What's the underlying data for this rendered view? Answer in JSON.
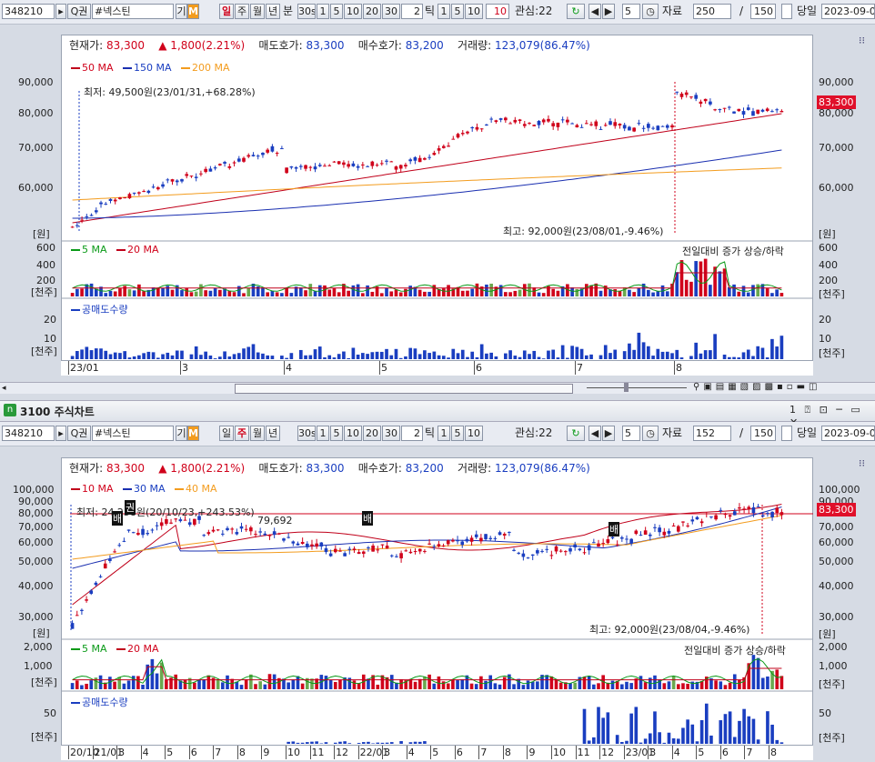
{
  "top": {
    "toolbar": {
      "code": "348210",
      "name": "#넥스틴",
      "gi": "기",
      "m": "M",
      "periods": [
        "일",
        "주",
        "월",
        "년",
        "분",
        "30s",
        "1",
        "5",
        "10",
        "20",
        "30"
      ],
      "tick_value": "2",
      "tick_label": "틱",
      "tick_opts": [
        "1",
        "5",
        "10",
        "10"
      ],
      "gwansim": "관심:22",
      "num5": "5",
      "jaryo": "자료",
      "jaryo_val": "250",
      "slash": "/",
      "count": "150",
      "dangil": "당일",
      "date": "2023-09-0"
    },
    "info": {
      "cur_label": "현재가:",
      "cur_val": "83,300",
      "chg": "▲ 1,800(2.21%)",
      "ask_label": "매도호가:",
      "ask_val": "83,300",
      "bid_label": "매수호가:",
      "bid_val": "83,200",
      "vol_label": "거래량:",
      "vol_val": "123,079(86.47%)"
    },
    "price": {
      "legend": [
        "50 MA",
        "150 MA",
        "200 MA"
      ],
      "min_note": "최저: 49,500원(23/01/31,+68.28%)",
      "max_note": "최고: 92,000원(23/08/01,-9.46%)",
      "y_ticks": [
        "90,000",
        "80,000",
        "70,000",
        "60,000"
      ],
      "unit": "[원]",
      "price_box": "83,300"
    },
    "volume": {
      "legend": [
        "5 MA",
        "20 MA"
      ],
      "note": "전일대비 증가 상승/하락",
      "y_ticks": [
        "600",
        "400",
        "200"
      ],
      "unit": "[천주]"
    },
    "short": {
      "legend": "공매도수량",
      "y_ticks": [
        "20",
        "10"
      ],
      "unit": "[천주]"
    },
    "xlabels": [
      "23/01",
      "3",
      "4",
      "5",
      "6",
      "7",
      "8"
    ]
  },
  "bottom": {
    "title": "3100 주식차트",
    "toolbar": {
      "code": "348210",
      "name": "#넥스틴",
      "gi": "기",
      "m": "M",
      "periods": [
        "일",
        "주",
        "월",
        "년",
        "30s",
        "1",
        "5",
        "10",
        "20",
        "30"
      ],
      "tick_value": "2",
      "tick_label": "틱",
      "tick_opts": [
        "1",
        "5",
        "10"
      ],
      "gwansim": "관심:22",
      "num5": "5",
      "jaryo": "자료",
      "jaryo_val": "152",
      "slash": "/",
      "count": "150",
      "dangil": "당일",
      "date": "2023-09-0"
    },
    "info": {
      "cur_label": "현재가:",
      "cur_val": "83,300",
      "chg": "▲ 1,800(2.21%)",
      "ask_label": "매도호가:",
      "ask_val": "83,300",
      "bid_label": "매수호가:",
      "bid_val": "83,200",
      "vol_label": "거래량:",
      "vol_val": "123,079(86.47%)"
    },
    "price": {
      "legend": [
        "10 MA",
        "30 MA",
        "40 MA"
      ],
      "min_note": "최저: 24,258원(20/10/23,+243.53%)",
      "max_note": "최고: 92,000원(23/08/04,-9.46%)",
      "line_label": "79,692",
      "marks": [
        "배",
        "권",
        "배",
        "배"
      ],
      "y_ticks": [
        "100,000",
        "90,000",
        "80,000",
        "70,000",
        "60,000",
        "50,000",
        "40,000",
        "30,000"
      ],
      "unit": "[원]",
      "price_box": "83,300"
    },
    "volume": {
      "legend": [
        "5 MA",
        "20 MA"
      ],
      "note": "전일대비 증가 상승/하락",
      "y_ticks": [
        "2,000",
        "1,000"
      ],
      "unit": "[천주]"
    },
    "short": {
      "legend": "공매도수량",
      "y_ticks": [
        "50"
      ],
      "unit": "[천주]"
    },
    "xlabels": [
      "20/10",
      "21/01",
      "3",
      "4",
      "5",
      "6",
      "7",
      "8",
      "9",
      "10",
      "11",
      "12",
      "22/01",
      "3",
      "4",
      "5",
      "6",
      "7",
      "8",
      "9",
      "10",
      "11",
      "12",
      "23/01",
      "3",
      "4",
      "5",
      "6",
      "7",
      "8"
    ]
  },
  "colors": {
    "up": "#d0021b",
    "down": "#1a3ec0",
    "ma_red": "#c0001a",
    "ma_blue": "#1a2fb0",
    "ma_orange": "#f39c1e",
    "ma_green": "#0a9a18"
  }
}
